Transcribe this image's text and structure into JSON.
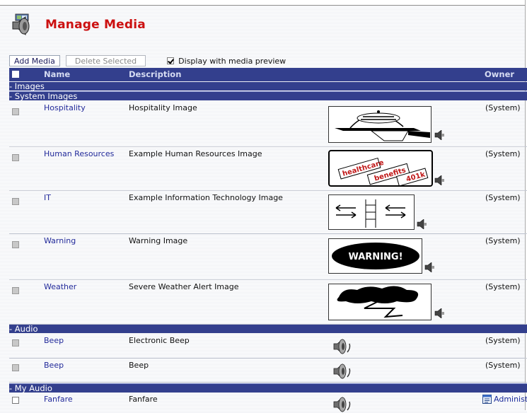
{
  "page": {
    "title": "Manage Media"
  },
  "toolbar": {
    "add_label": "Add Media",
    "delete_label": "Delete Selected",
    "preview_label": "Display with media preview",
    "preview_checked": true
  },
  "columns": {
    "name": "Name",
    "description": "Description",
    "owner": "Owner"
  },
  "groups": {
    "images": "- Images",
    "system_images": "- System Images",
    "audio": "- Audio",
    "my_audio": "- My Audio"
  },
  "images": [
    {
      "name": "Hospitality",
      "description": "Hospitality Image",
      "owner": "(System)"
    },
    {
      "name": "Human Resources",
      "description": "Example Human Resources Image",
      "owner": "(System)",
      "preview_words": [
        "healthcare",
        "benefits",
        "401k"
      ]
    },
    {
      "name": "IT",
      "description": "Example Information Technology Image",
      "owner": "(System)"
    },
    {
      "name": "Warning",
      "description": "Warning Image",
      "owner": "(System)",
      "preview_text": "WARNING!"
    },
    {
      "name": "Weather",
      "description": "Severe Weather Alert Image",
      "owner": "(System)"
    }
  ],
  "audio": [
    {
      "name": "Beep",
      "description": "Electronic Beep",
      "owner": "(System)"
    },
    {
      "name": "Beep",
      "description": "Beep",
      "owner": "(System)"
    }
  ],
  "my_audio": [
    {
      "name": "Fanfare",
      "description": "Fanfare",
      "owner": "Administ"
    }
  ],
  "colors": {
    "header_bar": "#333f8d",
    "title": "#cc1111",
    "link": "#222a9a"
  }
}
